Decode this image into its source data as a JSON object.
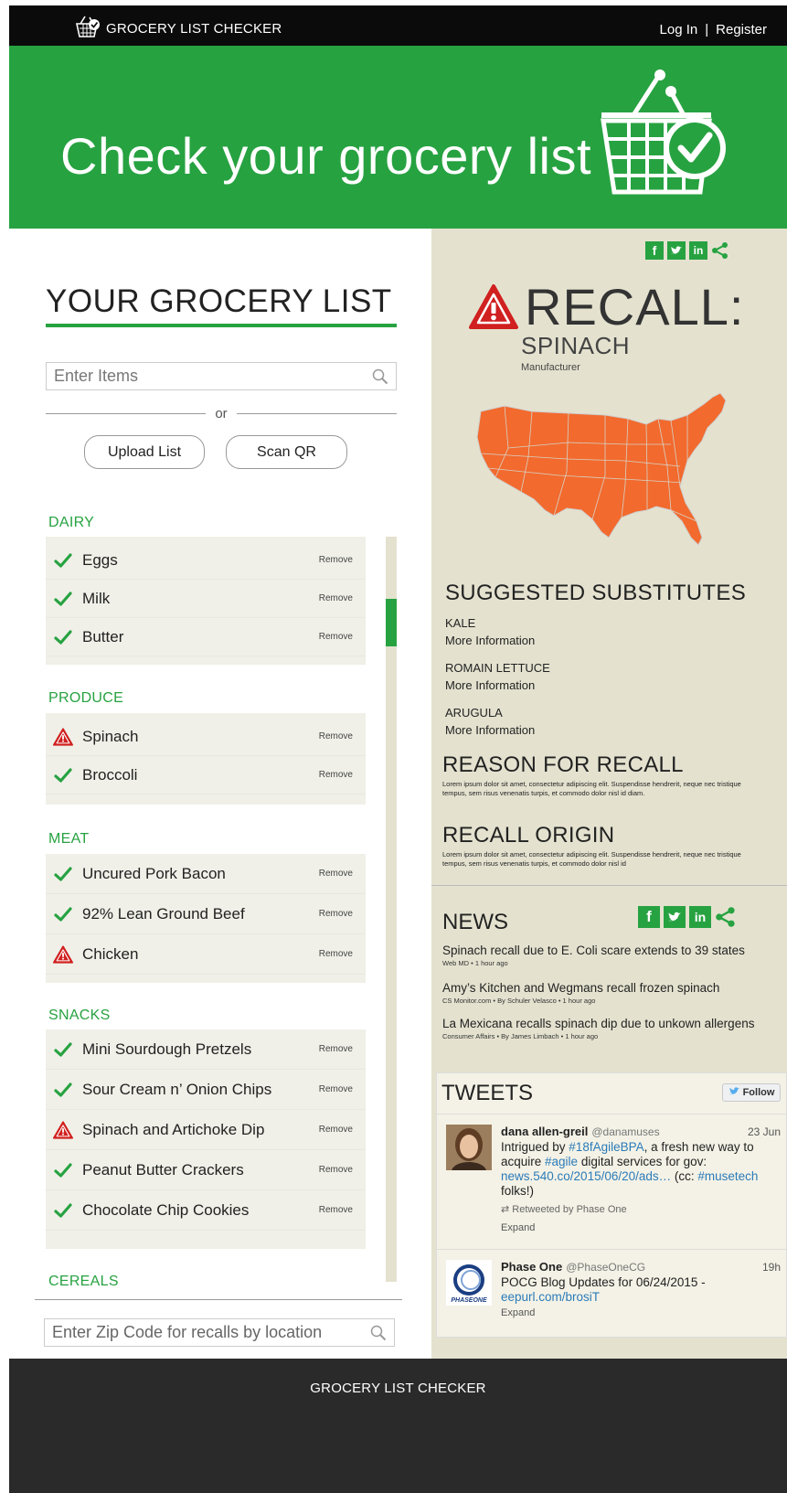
{
  "header": {
    "app_name": "GROCERY LIST CHECKER",
    "login": "Log In",
    "separator": "|",
    "register": "Register"
  },
  "hero": {
    "title": "Check your grocery list"
  },
  "list": {
    "title": "YOUR GROCERY LIST",
    "search_placeholder": "Enter Items",
    "or": "or",
    "upload_label": "Upload List",
    "scan_label": "Scan QR",
    "remove_label": "Remove",
    "categories": [
      {
        "name": "DAIRY",
        "items": [
          {
            "label": "Eggs",
            "status": "ok"
          },
          {
            "label": "Milk",
            "status": "ok"
          },
          {
            "label": "Butter",
            "status": "ok"
          }
        ]
      },
      {
        "name": "PRODUCE",
        "items": [
          {
            "label": "Spinach",
            "status": "recall"
          },
          {
            "label": "Broccoli",
            "status": "ok"
          }
        ]
      },
      {
        "name": "MEAT",
        "items": [
          {
            "label": "Uncured Pork Bacon",
            "status": "ok"
          },
          {
            "label": "92% Lean Ground Beef",
            "status": "ok"
          },
          {
            "label": "Chicken",
            "status": "recall"
          }
        ]
      },
      {
        "name": "SNACKS",
        "items": [
          {
            "label": "Mini Sourdough Pretzels",
            "status": "ok"
          },
          {
            "label": "Sour Cream n’ Onion Chips",
            "status": "ok"
          },
          {
            "label": "Spinach and Artichoke Dip",
            "status": "recall"
          },
          {
            "label": "Peanut Butter Crackers",
            "status": "ok"
          },
          {
            "label": "Chocolate Chip Cookies",
            "status": "ok"
          }
        ]
      },
      {
        "name": "CEREALS",
        "items": []
      }
    ],
    "zip_placeholder": "Enter Zip Code for recalls by location"
  },
  "social": {
    "facebook": "f",
    "twitter": "t",
    "linkedin": "in"
  },
  "recall": {
    "label": "RECALL:",
    "product": "SPINACH",
    "manufacturer": "Manufacturer",
    "substitutes_title": "SUGGESTED SUBSTITUTES",
    "more_info": "More Information",
    "substitutes": [
      "KALE",
      "ROMAIN LETTUCE",
      "ARUGULA"
    ],
    "reason_title": "REASON FOR RECALL",
    "reason_text": "Lorem ipsum dolor sit amet, consectetur adipiscing elit. Suspendisse hendrerit, neque nec tristique tempus, sem risus venenatis turpis, et commodo dolor nisl id diam.",
    "origin_title": "RECALL ORIGIN",
    "origin_text": "Lorem ipsum dolor sit amet, consectetur adipiscing elit. Suspendisse hendrerit, neque nec tristique tempus, sem risus venenatis turpis, et commodo dolor nisl id"
  },
  "news": {
    "title": "NEWS",
    "items": [
      {
        "headline": "Spinach recall due to E. Coli scare extends to 39 states",
        "meta": "Web MD • 1 hour ago"
      },
      {
        "headline": "Amy’s Kitchen and Wegmans recall frozen spinach",
        "meta": "CS Monitor.com • By Schuler Velasco • 1 hour ago"
      },
      {
        "headline": "La Mexicana recalls spinach dip due to unkown allergens",
        "meta": "Consumer Affairs • By James Limbach • 1 hour ago"
      }
    ]
  },
  "tweets": {
    "title": "TWEETS",
    "follow": "Follow",
    "items": [
      {
        "name": "dana allen-greil",
        "handle": "@danamuses",
        "date": "23 Jun",
        "text_parts": [
          "Intrigued by ",
          "#18fAgileBPA",
          ", a fresh new way to acquire ",
          "#agile",
          " digital services for gov: ",
          "news.540.co/2015/06/20/ads…",
          " (cc: ",
          "#musetech",
          " folks!)"
        ],
        "retweet": "Retweeted by Phase One",
        "expand": "Expand"
      },
      {
        "name": "Phase One",
        "handle": "@PhaseOneCG",
        "date": "19h",
        "text_parts": [
          "POCG Blog Updates for 06/24/2015 - ",
          "eepurl.com/brosiT"
        ],
        "expand": "Expand",
        "avatar_text": "PHASEONE"
      }
    ]
  },
  "footer": {
    "text": "GROCERY LIST CHECKER"
  },
  "colors": {
    "brand_green": "#27a241",
    "recall_red": "#d0201f",
    "map_orange": "#f26a2e",
    "panel_bg": "#e4e2cf"
  }
}
